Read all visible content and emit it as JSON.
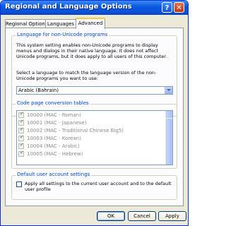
{
  "window": {
    "title": "Regional and Language Options",
    "help_glyph": "?",
    "close_glyph": "✕"
  },
  "tabs": [
    {
      "label": "Regional Options",
      "active": false
    },
    {
      "label": "Languages",
      "active": false
    },
    {
      "label": "Advanced",
      "active": true
    }
  ],
  "non_unicode": {
    "group_title": "Language for non-Unicode programs",
    "description": "This system setting enables non-Unicode programs to display menus and dialogs in their native language. It does not affect Unicode programs, but it does apply to all users of this computer.",
    "prompt": "Select a language to match the language version of the non-Unicode programs you want to use:",
    "selected_language": "Arabic (Bahrain)"
  },
  "code_pages": {
    "group_title": "Code page conversion tables",
    "items": [
      {
        "label": "10000 (MAC - Roman)",
        "checked": true
      },
      {
        "label": "10001 (MAC - Japanese)",
        "checked": true
      },
      {
        "label": "10002 (MAC - Traditional Chinese Big5)",
        "checked": true
      },
      {
        "label": "10003 (MAC - Korean)",
        "checked": true
      },
      {
        "label": "10004 (MAC - Arabic)",
        "checked": true
      },
      {
        "label": "10005 (MAC - Hebrew)",
        "checked": true
      }
    ]
  },
  "default_user": {
    "group_title": "Default user account settings",
    "checkbox_label": "Apply all settings to the current user account and to the default user profile",
    "checked": false
  },
  "buttons": {
    "ok": "OK",
    "cancel": "Cancel",
    "apply": "Apply"
  },
  "colors": {
    "title_bar": "#0a5ae0",
    "group_title": "#0046d5",
    "dialog_bg": "#ece9d8"
  }
}
